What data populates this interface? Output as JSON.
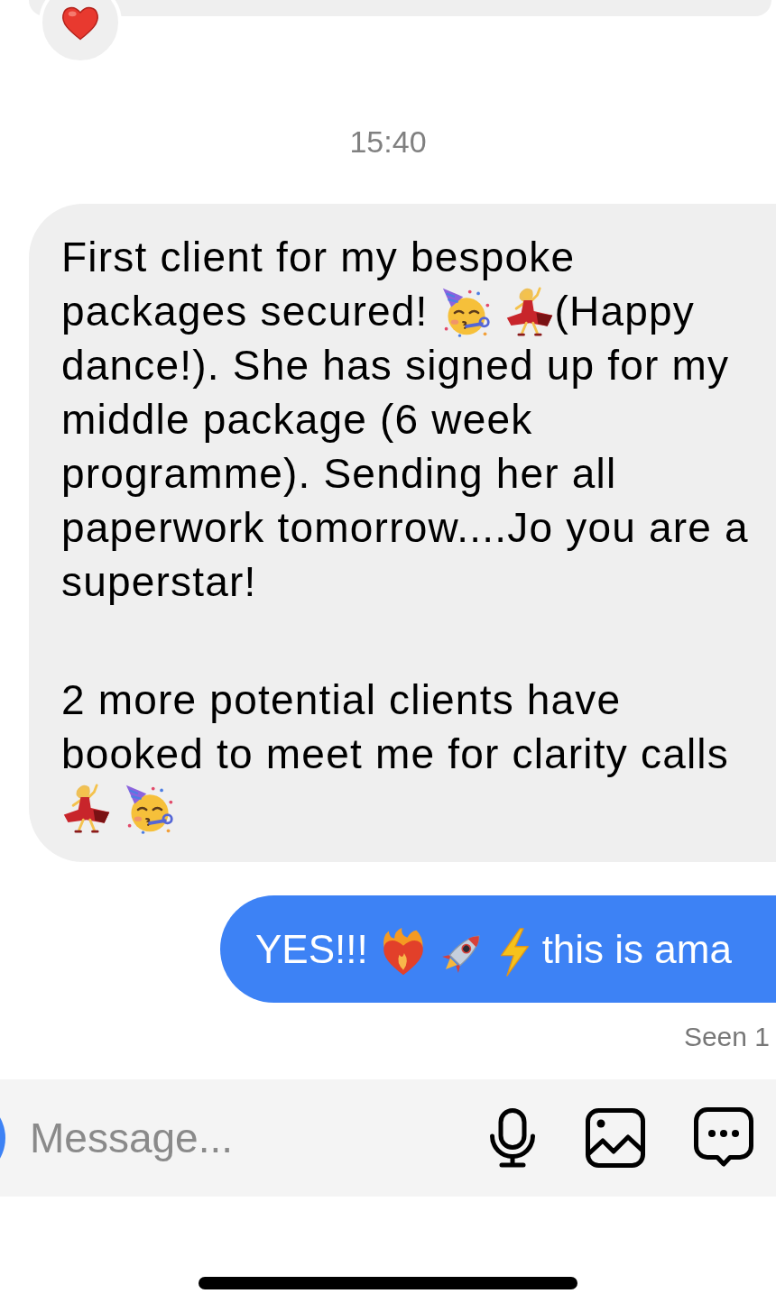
{
  "conversation": [
    {
      "kind": "received",
      "reacted": true
    },
    {
      "kind": "time",
      "text": "15:40"
    },
    {
      "kind": "received",
      "reacted": false,
      "paragraphs": [
        [
          {
            "kind": "text",
            "text": "First client for my bespoke packages secured! "
          },
          {
            "kind": "party"
          },
          {
            "kind": "dancer"
          },
          {
            "kind": "text",
            "text": "(Happy dance!). She has signed up for my middle package (6 week programme). Sending her all paperwork tomorrow....Jo you are a superstar!"
          }
        ],
        [
          {
            "kind": "text",
            "text": "2 more potential clients have booked to meet me for clarity calls "
          },
          {
            "kind": "dancer"
          },
          {
            "kind": "party"
          }
        ]
      ]
    },
    {
      "kind": "sent",
      "reacted": false,
      "paragraphs": [
        [
          {
            "kind": "text",
            "text": "YES!!! "
          },
          {
            "kind": "fireheart"
          },
          {
            "kind": "rocket"
          },
          {
            "kind": "bolt"
          },
          {
            "kind": "text",
            "text": " this is ama"
          }
        ]
      ]
    },
    {
      "kind": "receipt",
      "text": "Seen 1"
    }
  ],
  "composer": {
    "placeholder": "Message..."
  }
}
